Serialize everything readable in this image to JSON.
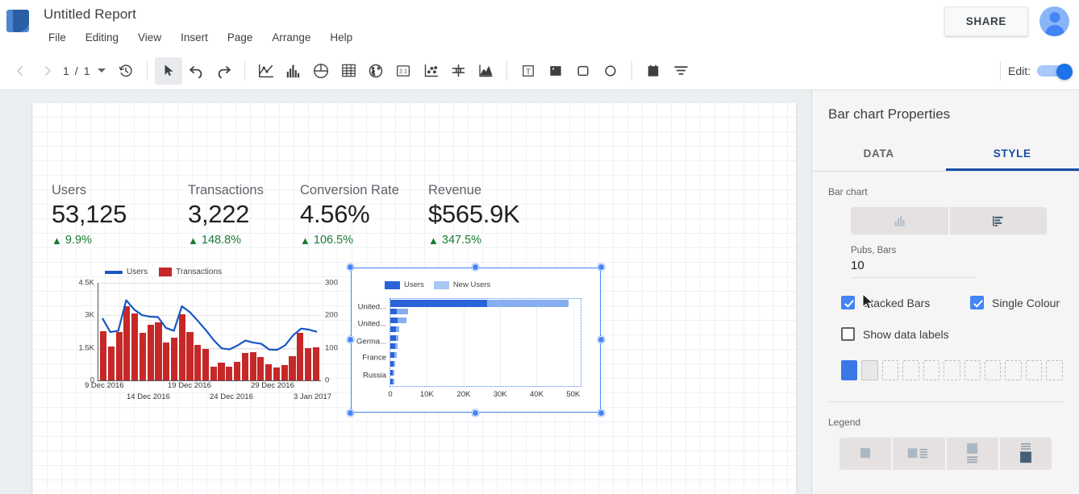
{
  "app": {
    "doc_title": "Untitled Report",
    "logo_icon": "data-studio-logo-icon",
    "share_label": "SHARE",
    "avatar_icon": "user-avatar-icon"
  },
  "menubar": {
    "items": [
      {
        "label": "File"
      },
      {
        "label": "Editing"
      },
      {
        "label": "View"
      },
      {
        "label": "Insert"
      },
      {
        "label": "Page"
      },
      {
        "label": "Arrange"
      },
      {
        "label": "Help"
      }
    ]
  },
  "toolbar": {
    "prev_icon": "chevron-left-icon",
    "next_icon": "chevron-right-icon",
    "page_current": "1",
    "page_sep": "/",
    "page_total": "1",
    "page_dropdown_icon": "chevron-down-icon",
    "history_icon": "version-history-icon",
    "select_icon": "select-cursor-icon",
    "undo_icon": "undo-icon",
    "redo_icon": "redo-icon",
    "timeseries_icon": "time-series-chart-icon",
    "bar_icon": "bar-chart-icon",
    "pie_icon": "pie-chart-icon",
    "table_icon": "table-icon",
    "geo_icon": "geo-map-icon",
    "scorecard_icon": "scorecard-icon",
    "scatter_icon": "scatter-chart-icon",
    "bullet_icon": "bullet-chart-icon",
    "area_icon": "area-chart-icon",
    "text_icon": "text-box-icon",
    "image_icon": "image-icon",
    "rect_icon": "rectangle-icon",
    "circle_icon": "circle-icon",
    "date_icon": "date-range-icon",
    "filter_icon": "filter-control-icon",
    "edit_label": "Edit:",
    "edit_toggle_on": true
  },
  "scorecards": [
    {
      "label": "Users",
      "value": "53,125",
      "delta": "9.9%",
      "arrow": "up-arrow-icon"
    },
    {
      "label": "Transactions",
      "value": "3,222",
      "delta": "148.8%",
      "arrow": "up-arrow-icon"
    },
    {
      "label": "Conversion Rate",
      "value": "4.56%",
      "delta": "106.5%",
      "arrow": "up-arrow-icon"
    },
    {
      "label": "Revenue",
      "value": "$565.9K",
      "delta": "347.5%",
      "arrow": "up-arrow-icon"
    }
  ],
  "chart_data": [
    {
      "type": "line",
      "name": "time-series-chart",
      "title": "",
      "legend": [
        {
          "label": "Users",
          "color": "#1a56c4",
          "marker": "line"
        },
        {
          "label": "Transactions",
          "color": "#c62828",
          "marker": "bar"
        }
      ],
      "legend_position": "top",
      "xlabel": "",
      "ylabel": "",
      "x_tick_labels": [
        "9 Dec 2016",
        "14 Dec 2016",
        "19 Dec 2016",
        "24 Dec 2016",
        "29 Dec 2016",
        "3 Jan 2017"
      ],
      "y_left_ticks": [
        "0",
        "1.5K",
        "3K",
        "4.5K"
      ],
      "y_left_lim": [
        0,
        4500
      ],
      "y_right_ticks": [
        "0",
        "100",
        "200",
        "300"
      ],
      "y_right_lim": [
        0,
        300
      ],
      "grid": true,
      "series": [
        {
          "name": "Users",
          "axis": "left",
          "color": "#1a56c4",
          "values": [
            2870,
            2230,
            2290,
            3700,
            3270,
            3010,
            2940,
            2920,
            2420,
            2290,
            3420,
            3150,
            2750,
            2330,
            1860,
            1480,
            1430,
            1610,
            1840,
            1740,
            1690,
            1420,
            1410,
            1620,
            2080,
            2390,
            2340,
            2240
          ]
        },
        {
          "name": "Transactions",
          "axis": "right",
          "color": "#c62828",
          "values": [
            152,
            104,
            148,
            228,
            206,
            147,
            172,
            178,
            117,
            132,
            203,
            148,
            108,
            96,
            42,
            54,
            42,
            58,
            84,
            88,
            72,
            50,
            40,
            48,
            74,
            146,
            98,
            102
          ]
        }
      ]
    },
    {
      "type": "bar",
      "name": "country-bar-chart",
      "orientation": "horizontal",
      "stacked": true,
      "selected": true,
      "legend": [
        {
          "label": "Users",
          "color": "#2a63d8"
        },
        {
          "label": "New Users",
          "color": "#86aef0"
        }
      ],
      "legend_position": "top",
      "categories": [
        "United...",
        "United...",
        "Germa...",
        "France",
        "Russia"
      ],
      "all_categories": [
        "United...",
        "",
        "United...",
        "",
        "Germa...",
        "",
        "France",
        "",
        "Russia",
        ""
      ],
      "x_tick_labels": [
        "0",
        "10K",
        "20K",
        "30K",
        "40K",
        "50K"
      ],
      "xlim": [
        0,
        52000
      ],
      "series": [
        {
          "name": "Users",
          "values": [
            26500,
            1700,
            2050,
            1550,
            1450,
            1250,
            1150,
            900,
            750,
            700
          ]
        },
        {
          "name": "New Users",
          "values": [
            22300,
            3050,
            2300,
            900,
            850,
            700,
            600,
            500,
            450,
            400
          ]
        }
      ]
    }
  ],
  "panel": {
    "title": "Bar chart Properties",
    "tabs": [
      {
        "label": "DATA",
        "selected": false
      },
      {
        "label": "STYLE",
        "selected": true
      }
    ],
    "bar_chart_section": {
      "label": "Bar chart",
      "orientation_options": [
        {
          "icon": "vertical-bar-chart-icon",
          "selected": false
        },
        {
          "icon": "horizontal-bar-chart-icon",
          "selected": true
        }
      ],
      "bars_field_label": "Pubs, Bars",
      "bars_field_value": "10",
      "checkboxes": [
        {
          "label": "Stacked Bars",
          "checked": true
        },
        {
          "label": "Single Colour",
          "checked": true
        },
        {
          "label": "Show data labels",
          "checked": false
        }
      ],
      "swatches": [
        {
          "state": "filled",
          "color": "#3b78e7"
        },
        {
          "state": "filled",
          "color": "#e8e8e8"
        },
        {
          "state": "empty"
        },
        {
          "state": "empty"
        },
        {
          "state": "empty"
        },
        {
          "state": "empty"
        },
        {
          "state": "empty"
        },
        {
          "state": "empty"
        },
        {
          "state": "empty"
        },
        {
          "state": "empty"
        },
        {
          "state": "empty"
        }
      ]
    },
    "legend_section": {
      "label": "Legend",
      "options": [
        {
          "icon": "legend-none-icon",
          "selected": false
        },
        {
          "icon": "legend-right-icon",
          "selected": false
        },
        {
          "icon": "legend-bottom-icon",
          "selected": false
        },
        {
          "icon": "legend-top-icon",
          "selected": true
        }
      ]
    }
  },
  "colors": {
    "accent": "#4285f4",
    "tab_selected": "#174ea6",
    "positive": "#1b7a34",
    "users_line": "#1a56c4",
    "transactions_bar": "#c62828",
    "bar_primary": "#2a63d8",
    "bar_secondary": "#86aef0"
  }
}
